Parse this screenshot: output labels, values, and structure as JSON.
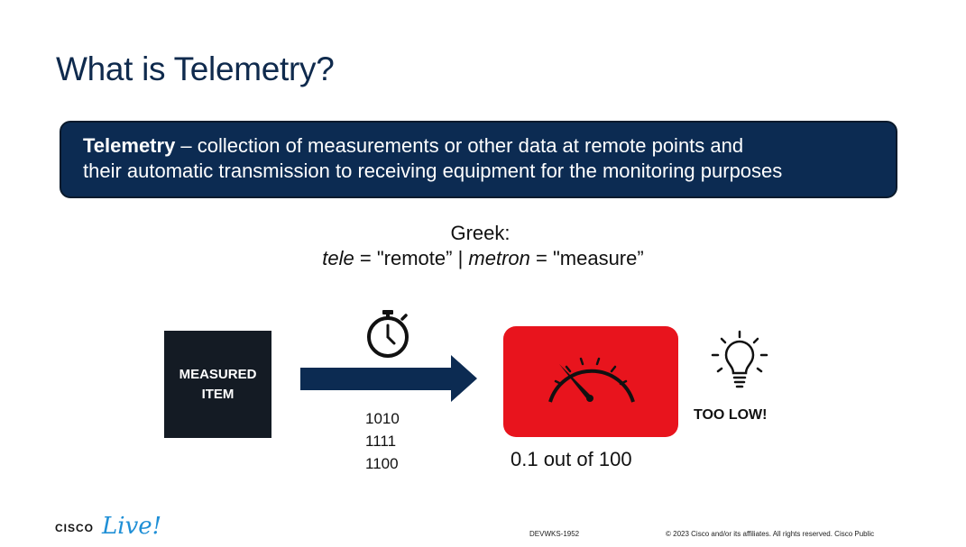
{
  "slide": {
    "title": "What is Telemetry?",
    "definition": {
      "term": "Telemetry",
      "line1_rest": " – collection of measurements or other data at remote points and",
      "line2": "their automatic transmission to receiving equipment for the monitoring purposes"
    },
    "greek": {
      "heading": "Greek:",
      "tele_word": "tele",
      "tele_meaning": " = \"remote” | ",
      "metron_word": "metron",
      "metron_meaning": " = \"measure”"
    },
    "diagram": {
      "item_line1": "MEASURED",
      "item_line2": "ITEM",
      "bits": [
        "1010",
        "1111",
        "1100"
      ],
      "reading": "0.1 out of 100",
      "status": "TOO LOW!",
      "gauge_color": "#e8141d",
      "item_color": "#141b24",
      "arrow_color": "#0c2b52"
    },
    "footer": {
      "logo_cisco": "CISCO",
      "logo_live": "Live!",
      "code": "DEVWKS-1952",
      "copyright": "© 2023  Cisco and/or its affiliates. All rights reserved.   Cisco Public"
    }
  }
}
